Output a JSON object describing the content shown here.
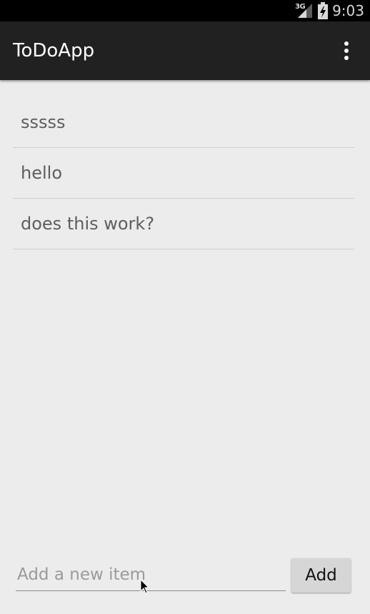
{
  "status_bar": {
    "network_type": "3G",
    "time": "9:03",
    "icons": [
      "signal-icon",
      "battery-icon"
    ]
  },
  "action_bar": {
    "title": "ToDoApp",
    "overflow_icon": "more-vert-icon"
  },
  "todo_items": [
    "sssss",
    "hello",
    "does this work?"
  ],
  "new_item": {
    "placeholder": "Add a new item",
    "value": ""
  },
  "add_button": {
    "label": "Add"
  },
  "colors": {
    "action_bar": "#212121",
    "status_bar": "#000000",
    "background": "#ececec",
    "item_text": "#5e5e5e",
    "divider": "#cfcfcf",
    "button": "#d6d6d6"
  }
}
